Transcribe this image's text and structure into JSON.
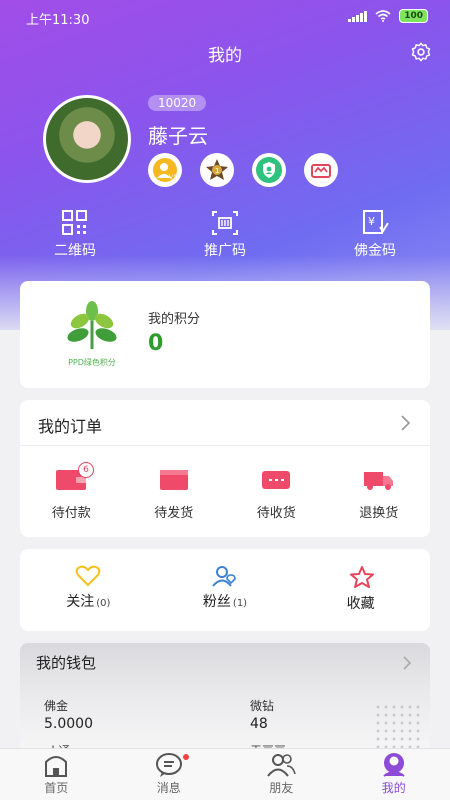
{
  "status": {
    "time": "上午11:30",
    "battery": "100"
  },
  "header": {
    "title": "我的"
  },
  "profile": {
    "uid": "10020",
    "name": "藤子云",
    "medals": [
      "v1-medal-icon",
      "rank-medal-icon",
      "shield-medal-icon",
      "crown-medal-icon"
    ]
  },
  "codes": [
    {
      "label": "二维码",
      "icon": "qr-code-icon"
    },
    {
      "label": "推广码",
      "icon": "promo-code-icon"
    },
    {
      "label": "佛金码",
      "icon": "yuan-code-icon"
    }
  ],
  "points": {
    "logo_text": "PPD绿色积分",
    "label": "我的积分",
    "value": "0"
  },
  "orders": {
    "title": "我的订单",
    "items": [
      {
        "label": "待付款",
        "icon": "wallet-icon",
        "badge": "6"
      },
      {
        "label": "待发货",
        "icon": "box-icon"
      },
      {
        "label": "待收货",
        "icon": "card-icon"
      },
      {
        "label": "退换货",
        "icon": "truck-icon"
      }
    ]
  },
  "social": {
    "items": [
      {
        "label": "关注",
        "count": "(0)",
        "icon": "heart-icon"
      },
      {
        "label": "粉丝",
        "count": "(1)",
        "icon": "fans-icon"
      },
      {
        "label": "收藏",
        "count": "",
        "icon": "star-icon"
      }
    ]
  },
  "wallet": {
    "title": "我的钱包",
    "fojin_label": "佛金",
    "fojin_value": "5.0000",
    "weizuan_label": "微钻",
    "weizuan_value": "48",
    "cut_left": "ok通",
    "cut_right": "贡豆豆"
  },
  "tabs": [
    {
      "label": "首页",
      "icon": "home-icon"
    },
    {
      "label": "消息",
      "icon": "message-icon"
    },
    {
      "label": "朋友",
      "icon": "friends-icon"
    },
    {
      "label": "我的",
      "icon": "profile-icon"
    }
  ],
  "colors": {
    "accent": "#8d4bd8",
    "points_green": "#2e9b2a",
    "order_red": "#f04a6a"
  }
}
